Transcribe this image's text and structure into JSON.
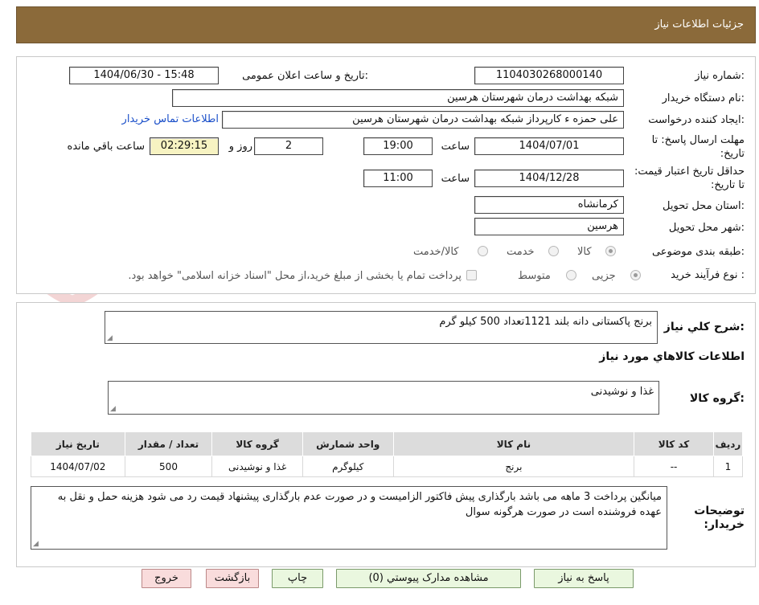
{
  "header": {
    "title": "جزئیات اطلاعات نیاز"
  },
  "form": {
    "need_number_label": "شماره نیاز:",
    "need_number": "1104030268000140",
    "announce_label": "تاریخ و ساعت اعلان عمومی:",
    "announce_value": "1404/06/30 - 15:48",
    "buyer_label": "نام دستگاه خریدار:",
    "buyer_value": "شبکه بهداشت درمان شهرستان هرسین",
    "creator_label": "ایجاد کننده درخواست:",
    "creator_value": "علی حمزه ء کارپرداز شبکه بهداشت درمان شهرستان هرسین",
    "contact_link": "اطلاعات تماس خریدار",
    "deadline_label": "مهلت ارسال پاسخ: تا تاریخ:",
    "deadline_date": "1404/07/01",
    "time_word": "ساعت",
    "deadline_time": "19:00",
    "days_value": "2",
    "days_word": "روز و",
    "remaining_value": "02:29:15",
    "remaining_word": "ساعت باقي مانده",
    "validity_label": "حداقل تاریخ اعتبار قیمت: تا تاریخ:",
    "validity_date": "1404/12/28",
    "validity_time": "11:00",
    "province_label": "استان محل تحویل:",
    "province_value": "کرمانشاه",
    "city_label": "شهر محل تحویل:",
    "city_value": "هرسین",
    "category_label": "طبقه بندی موضوعی:",
    "category_options": [
      "کالا",
      "خدمت",
      "کالا/خدمت"
    ],
    "process_label": "نوع فرآیند خرید :",
    "process_options": [
      "جزیی",
      "متوسط"
    ],
    "payment_note": "پرداخت تمام یا بخشی از مبلغ خرید،از محل \"اسناد خزانه اسلامی\" خواهد بود."
  },
  "need": {
    "summary_label": "شرح کلي نياز:",
    "summary_value": "برنج پاکستانی دانه بلند 1121تعداد 500 کیلو گرم",
    "goods_info_title": "اطلاعات کالاهاي مورد نياز",
    "group_label": "گروه کالا:",
    "group_value": "غذا و نوشیدنی"
  },
  "table": {
    "headers": [
      "رديف",
      "کد کالا",
      "نام کالا",
      "واحد شمارش",
      "گروه کالا",
      "تعداد / مقدار",
      "تاریخ نیاز"
    ],
    "rows": [
      [
        "1",
        "--",
        "برنج",
        "کیلوگرم",
        "غذا و نوشیدنی",
        "500",
        "1404/07/02"
      ]
    ]
  },
  "notes": {
    "label": "توضیحات خریدار:",
    "value": "میانگین پرداخت 3 ماهه می باشد بارگذاری پیش فاکتور الزامیست و در صورت عدم بارگذاری پیشنهاد قیمت رد می شود هزینه حمل و نقل به عهده فروشنده است در صورت هرگونه سوال"
  },
  "buttons": {
    "reply": "پاسخ به نیاز",
    "attachments": "مشاهده مدارک پیوستي (0)",
    "print": "چاپ",
    "back": "بازگشت",
    "exit": "خروج"
  },
  "watermark": {
    "text": "AriaTender.neT"
  },
  "colors": {
    "header_bg": "#8b6a3a",
    "button_bg": "#eaf7df",
    "button_red_bg": "#f9dcdc",
    "remaining_bg": "#f7f3c2",
    "link": "#1a4fc9"
  }
}
